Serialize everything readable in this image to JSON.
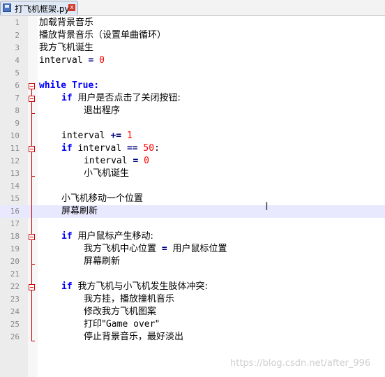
{
  "tab": {
    "title": "打飞机框架.py"
  },
  "lines": [
    {
      "n": "1",
      "text": "加载背景音乐"
    },
    {
      "n": "2",
      "text": "播放背景音乐（设置单曲循环）"
    },
    {
      "n": "3",
      "text": "我方飞机诞生"
    },
    {
      "n": "4",
      "text": "interval = 0"
    },
    {
      "n": "5",
      "text": ""
    },
    {
      "n": "6",
      "text": "while True:"
    },
    {
      "n": "7",
      "text": "if 用户是否点击了关闭按钮:"
    },
    {
      "n": "8",
      "text": "退出程序"
    },
    {
      "n": "9",
      "text": ""
    },
    {
      "n": "10",
      "text": "interval += 1"
    },
    {
      "n": "11",
      "text": "if interval == 50:"
    },
    {
      "n": "12",
      "text": "interval = 0"
    },
    {
      "n": "13",
      "text": "小飞机诞生"
    },
    {
      "n": "14",
      "text": ""
    },
    {
      "n": "15",
      "text": "小飞机移动一个位置"
    },
    {
      "n": "16",
      "text": "屏幕刷新"
    },
    {
      "n": "17",
      "text": ""
    },
    {
      "n": "18",
      "text": "if 用户鼠标产生移动:"
    },
    {
      "n": "19",
      "text": "我方飞机中心位置 = 用户鼠标位置"
    },
    {
      "n": "20",
      "text": "屏幕刷新"
    },
    {
      "n": "21",
      "text": ""
    },
    {
      "n": "22",
      "text": "if 我方飞机与小飞机发生肢体冲突:"
    },
    {
      "n": "23",
      "text": "我方挂，播放撞机音乐"
    },
    {
      "n": "24",
      "text": "修改我方飞机图案"
    },
    {
      "n": "25",
      "text": "打印\"Game over\""
    },
    {
      "n": "26",
      "text": "停止背景音乐，最好淡出"
    }
  ],
  "tokens": {
    "interval": "interval",
    "eq": "=",
    "zero": "0",
    "while": "while",
    "true": "True:",
    "if": "if",
    "pluseq": "+=",
    "one": "1",
    "eqeq": "==",
    "fifty": "50",
    "colon": ":",
    "cond7": "用户是否点击了关闭按钮:",
    "line19a": "我方飞机中心位置",
    "line19b": "用户鼠标位置",
    "cond18": "用户鼠标产生移动:",
    "cond22": "我方飞机与小飞机发生肢体冲突:",
    "line25a": "打印\"",
    "line25b": "Game over",
    "line25c": "\""
  },
  "watermark": "https://blog.csdn.net/after_996",
  "colors": {
    "keyword": "#0000ff",
    "number": "#ff0000",
    "current_line": "#e8e8ff",
    "fold_marker": "#cc0000"
  }
}
